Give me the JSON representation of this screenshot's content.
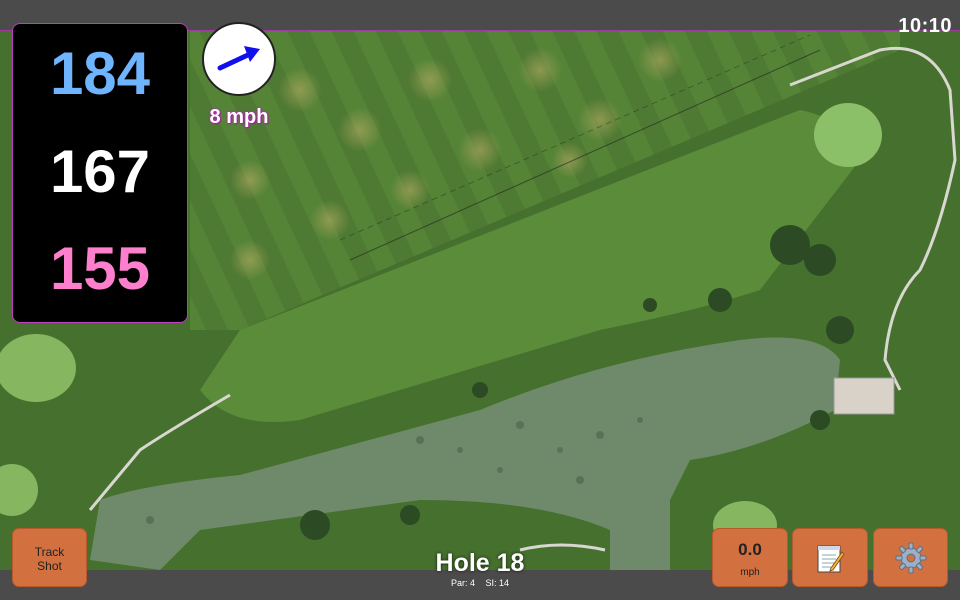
{
  "status": {
    "time": "10:10"
  },
  "distances": {
    "back": "184",
    "middle": "167",
    "front": "155",
    "colors": {
      "back": "#6fb4ff",
      "middle": "#ffffff",
      "front": "#ff7fcf",
      "panel_border": "#c03cc0"
    }
  },
  "wind": {
    "speed": "8 mph",
    "direction_icon": "arrow-right-up-icon",
    "arrow_color": "#1010ee"
  },
  "hole": {
    "title": "Hole 18",
    "par": "Par: 4",
    "stroke_index": "SI: 14"
  },
  "buttons": {
    "track_shot_line1": "Track",
    "track_shot_line2": "Shot",
    "speed_value": "0.0",
    "speed_unit": "mph",
    "notes_icon": "notepad-icon",
    "settings_icon": "gear-icon",
    "color": "#d2703f"
  },
  "map": {
    "type": "satellite",
    "features": [
      "fairway",
      "greens",
      "water-hazard",
      "cart-path",
      "driving-range-nets",
      "clubhouse"
    ]
  }
}
